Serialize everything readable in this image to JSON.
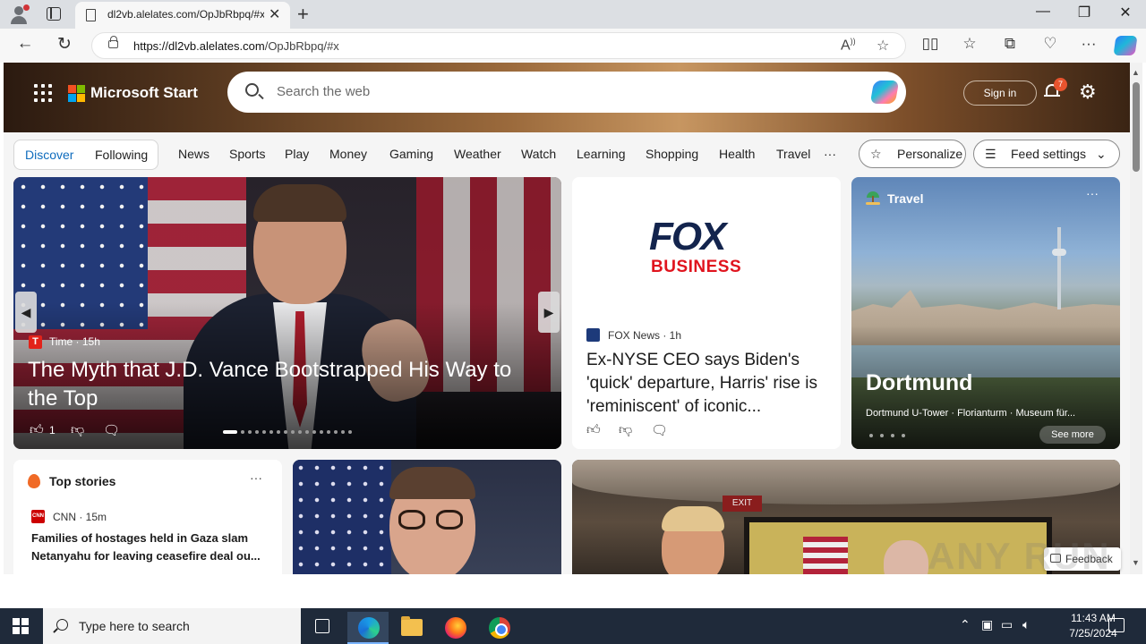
{
  "browser": {
    "tab_title": "dl2vb.alelates.com/OpJbRbpq/#x",
    "url_host": "https://dl2vb.alelates.com",
    "url_path": "/OpJbRbpq/#x"
  },
  "header": {
    "brand": "Microsoft Start",
    "search_placeholder": "Search the web",
    "signin_label": "Sign in",
    "notification_count": "7"
  },
  "nav": {
    "discover": "Discover",
    "following": "Following",
    "links": [
      "News",
      "Sports",
      "Play",
      "Money",
      "Gaming",
      "Weather",
      "Watch",
      "Learning",
      "Shopping",
      "Health",
      "Travel"
    ],
    "more": "···",
    "personalize": "Personalize",
    "feed_settings": "Feed settings"
  },
  "hero": {
    "source": "Time · 15h",
    "source_logo": "T",
    "title": "The Myth that J.D. Vance Bootstrapped His Way to the Top",
    "likes": "1"
  },
  "fox_card": {
    "logo_word": "FOX",
    "logo_sub": "BUSINESS",
    "source": "FOX News · 1h",
    "title": "Ex-NYSE CEO says Biden's 'quick' departure, Harris' rise is 'reminiscent' of iconic..."
  },
  "travel_card": {
    "label": "Travel",
    "more": "···",
    "title": "Dortmund",
    "subtitle": "Dortmund U-Tower · Florianturm · Museum für...",
    "see_more": "See more"
  },
  "top_stories": {
    "title": "Top stories",
    "more": "···",
    "source": "CNN · 15m",
    "source_logo": "CNN",
    "headline": "Families of hostages held in Gaza slam Netanyahu for leaving ceasefire deal ou..."
  },
  "trump_card": {
    "exit_sign": "EXIT"
  },
  "feedback_label": "Feedback",
  "watermark": "ANY RUN",
  "taskbar": {
    "search_placeholder": "Type here to search",
    "time": "11:43 AM",
    "date": "7/25/2024"
  }
}
